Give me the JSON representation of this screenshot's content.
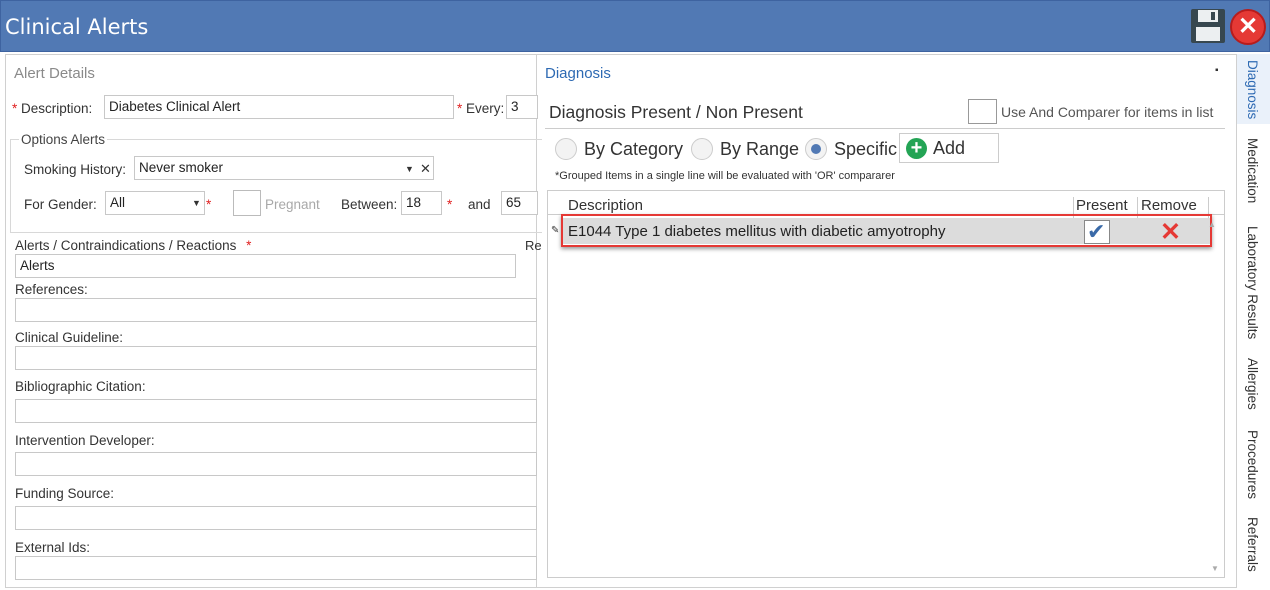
{
  "window": {
    "title": "Clinical Alerts"
  },
  "alert_details": {
    "section_title": "Alert Details",
    "description_label": "Description:",
    "description_value": "Diabetes Clinical Alert",
    "every_label": "Every:",
    "every_value": "3",
    "options_title": "Options Alerts",
    "smoking_label": "Smoking History:",
    "smoking_value": "Never smoker",
    "clear_symbol": "✕",
    "gender_label": "For Gender:",
    "gender_value": "All",
    "pregnant_label": "Pregnant",
    "between_label": "Between:",
    "between_from": "18",
    "and_label": "and",
    "between_to": "65",
    "alerts_label": "Alerts / Contraindications / Reactions",
    "cut_label": "Re",
    "alerts_value": "Alerts",
    "references_label": "References:",
    "clinical_guideline_label": "Clinical Guideline:",
    "bibliographic_label": "Bibliographic Citation:",
    "intervention_label": "Intervention Developer:",
    "funding_label": "Funding Source:",
    "external_ids_label": "External Ids:",
    "required_marker": "*"
  },
  "diagnosis": {
    "panel_title": "Diagnosis",
    "subtitle": "Diagnosis Present / Non Present",
    "use_and_label": "Use And Comparer for items in list",
    "mode_options": [
      "By Category",
      "By Range",
      "Specific"
    ],
    "selected_mode": "Specific",
    "add_label": "Add",
    "hint": "*Grouped Items in a single line will be evaluated with 'OR' compararer",
    "columns": [
      "Description",
      "Present",
      "Remove"
    ],
    "rows": [
      {
        "description": "E1044 Type 1 diabetes mellitus with diabetic amyotrophy",
        "present": true
      }
    ]
  },
  "side_tabs": [
    "Diagnosis",
    "Medication",
    "Laboratory Results",
    "Allergies",
    "Procedures",
    "Referrals"
  ],
  "colors": {
    "title_bar": "#5179b4",
    "accent": "#2e6ab3",
    "highlight": "#e53935",
    "add_green": "#23a455"
  }
}
